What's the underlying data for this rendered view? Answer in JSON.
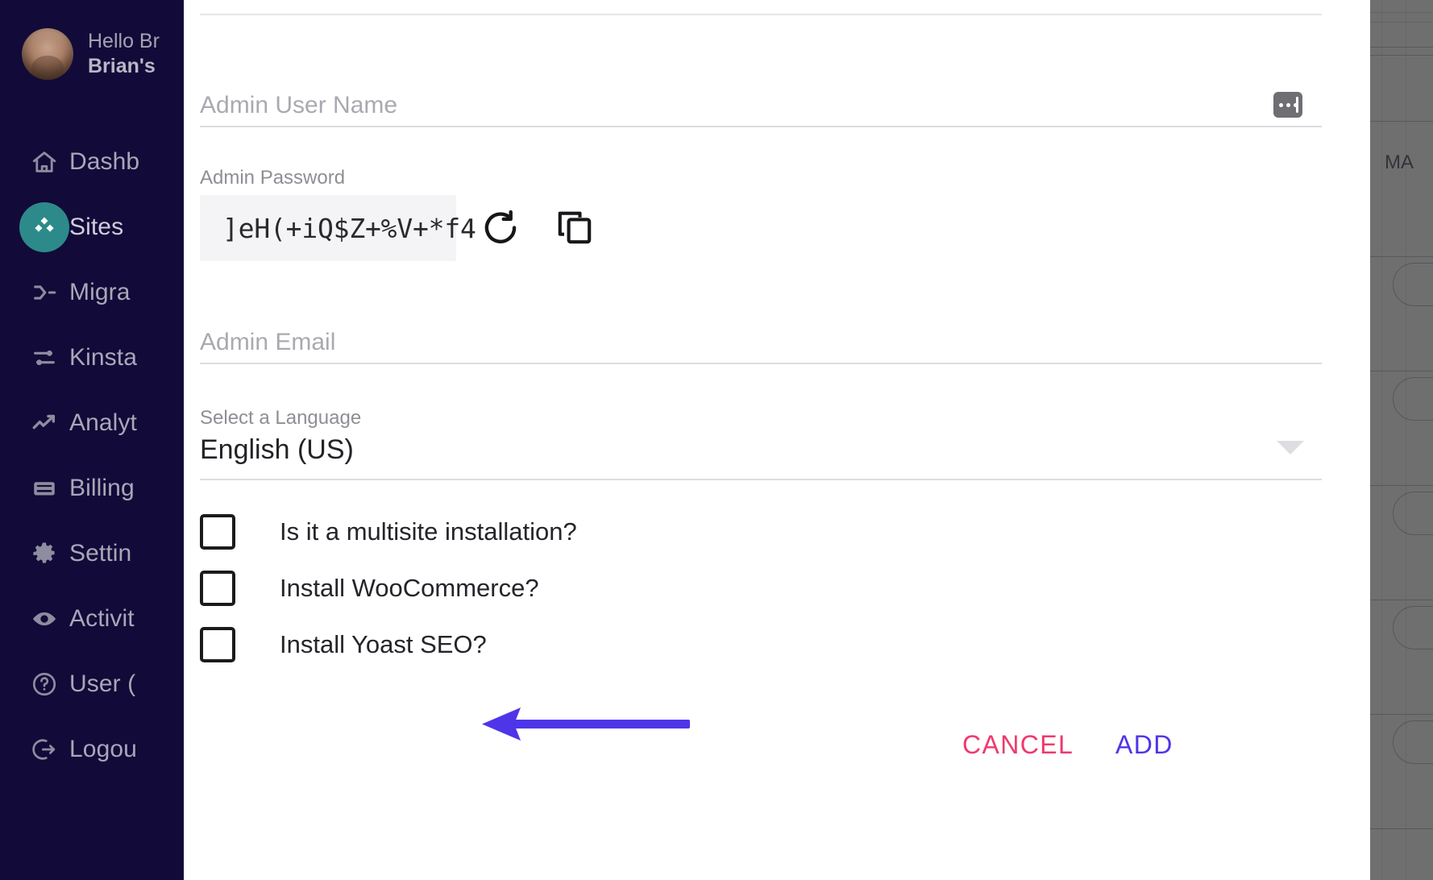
{
  "sidebar": {
    "profile": {
      "greeting": "Hello Br",
      "account": "Brian's",
      "avatar_name": "user-avatar"
    },
    "items": [
      {
        "label": "Dashb",
        "icon": "home-icon",
        "active": false
      },
      {
        "label": "Sites",
        "icon": "sites-icon",
        "active": true
      },
      {
        "label": "Migra",
        "icon": "migration-icon",
        "active": false
      },
      {
        "label": "Kinsta",
        "icon": "kinsta-cdn-icon",
        "active": false
      },
      {
        "label": "Analyt",
        "icon": "analytics-icon",
        "active": false
      },
      {
        "label": "Billing",
        "icon": "billing-icon",
        "active": false
      },
      {
        "label": "Settin",
        "icon": "gear-icon",
        "active": false
      },
      {
        "label": "Activit",
        "icon": "eye-icon",
        "active": false
      },
      {
        "label": "User (",
        "icon": "help-icon",
        "active": false
      },
      {
        "label": "Logou",
        "icon": "logout-icon",
        "active": false
      }
    ]
  },
  "backdrop": {
    "column_header": "MA"
  },
  "modal": {
    "username": {
      "placeholder": "Admin User Name",
      "value": "",
      "autofill_icon": "password-suggestion-icon"
    },
    "password": {
      "label": "Admin Password",
      "value": "]eH(+iQ$Z+%V+*f4",
      "regenerate_icon": "refresh-icon",
      "copy_icon": "copy-icon"
    },
    "email": {
      "placeholder": "Admin Email",
      "value": ""
    },
    "language": {
      "label": "Select a Language",
      "value": "English (US)",
      "caret_icon": "chevron-down-icon"
    },
    "checkboxes": [
      {
        "label": "Is it a multisite installation?",
        "checked": false
      },
      {
        "label": "Install WooCommerce?",
        "checked": false
      },
      {
        "label": "Install Yoast SEO?",
        "checked": false
      }
    ],
    "footer": {
      "cancel_label": "CANCEL",
      "add_label": "ADD"
    }
  },
  "annotation": {
    "arrow_color": "#4f35e8",
    "points_to": "Install Yoast SEO?"
  },
  "colors": {
    "sidebar_bg": "#120a38",
    "accent_teal": "#2d8a8a",
    "cancel_pink": "#ef3a6e",
    "add_purple": "#4f35e8",
    "backdrop_gray": "#6f6f6f"
  }
}
